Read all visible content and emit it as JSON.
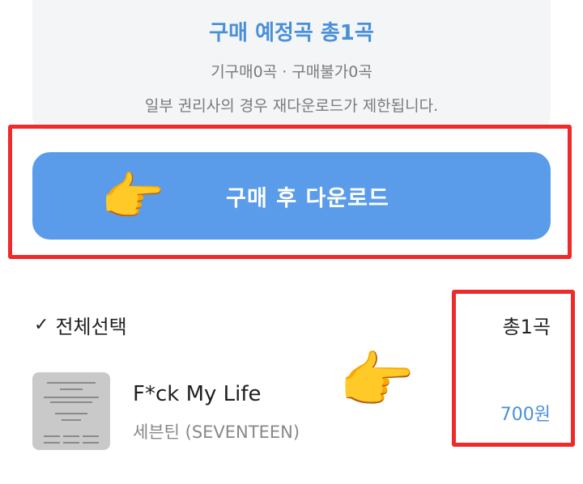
{
  "summary": {
    "title": "구매 예정곡 총1곡",
    "subtitle": "기구매0곡 · 구매불가0곡",
    "note": "일부 권리사의 경우 재다운로드가 제한됩니다."
  },
  "action": {
    "buy_label": "구매 후 다운로드"
  },
  "list": {
    "select_all_label": "전체선택",
    "total_count": "총1곡",
    "items": [
      {
        "title": "F*ck My Life",
        "artist": "세븐틴 (SEVENTEEN)",
        "price": "700원"
      }
    ]
  },
  "colors": {
    "accent": "#4a90d9",
    "button": "#5a9ce9",
    "highlight": "#ee2a2a"
  },
  "icons": {
    "pointer": "backhand-index-pointing-right-icon",
    "check": "check-icon"
  }
}
